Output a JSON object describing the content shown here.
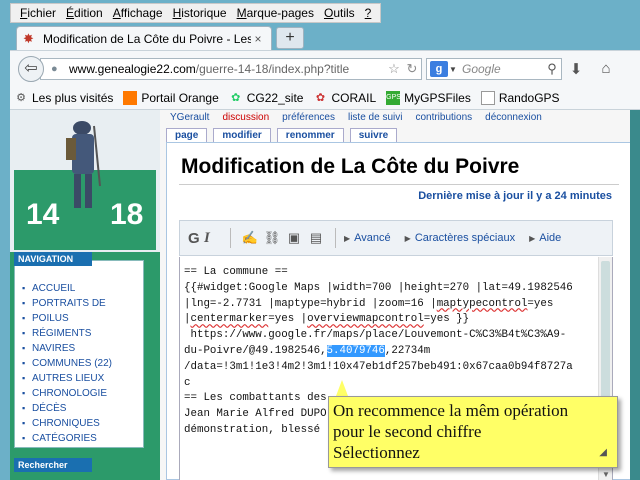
{
  "menu": [
    {
      "label": "Fichier",
      "u": "F",
      "rest": "ichier"
    },
    {
      "label": "Édition",
      "u": "É",
      "rest": "dition"
    },
    {
      "label": "Affichage",
      "u": "A",
      "rest": "ffichage"
    },
    {
      "label": "Historique",
      "u": "H",
      "rest": "istorique"
    },
    {
      "label": "Marque-pages",
      "u": "M",
      "rest": "arque-pages"
    },
    {
      "label": "Outils",
      "u": "O",
      "rest": "utils"
    },
    {
      "label": "?",
      "u": "?",
      "rest": ""
    }
  ],
  "tab": {
    "title": "Modification de La Côte du Poivre - Les ...",
    "close": "×",
    "new": "+"
  },
  "url": {
    "host": "www.genealogie22.com",
    "path": "/guerre-14-18/index.php?title"
  },
  "search": {
    "engine": "g",
    "placeholder": "Google"
  },
  "bookmarks": [
    {
      "label": "Les plus visités",
      "icon": "gear-icon"
    },
    {
      "label": "Portail Orange",
      "icon": "orange-icon"
    },
    {
      "label": "CG22_site",
      "icon": "cg22-icon"
    },
    {
      "label": "CORAIL",
      "icon": "corail-icon"
    },
    {
      "label": "MyGPSFiles",
      "icon": "gps-icon"
    },
    {
      "label": "RandoGPS",
      "icon": "page-icon"
    }
  ],
  "personal": [
    "YGerault",
    "discussion",
    "préférences",
    "liste de suivi",
    "contributions",
    "déconnexion"
  ],
  "page_tabs": [
    "page",
    "modifier",
    "renommer",
    "suivre"
  ],
  "logo": {
    "left_num": "14",
    "right_num": "18"
  },
  "heading": "Modification de La Côte du Poivre",
  "last_modified": "Dernière mise à jour il y a 24 minutes",
  "editor_toolbar": {
    "bold": "G",
    "italic": "I",
    "advanced": "Avancé",
    "special": "Caractères spéciaux",
    "help": "Aide"
  },
  "code": {
    "l1": "== La commune ==",
    "l2": "{{#widget:Google Maps |width=700 |height=270 |lat=49.1982546",
    "l3a": "|lng=-2.7731 |maptype=hybrid |zoom=16 |",
    "l3b": "maptypecontrol",
    "l3c": "=yes",
    "l4a": "|",
    "l4b": "centermarker",
    "l4c": "=yes |",
    "l4d": "overviewmapcontrol",
    "l4e": "=yes }}",
    "l5": " https://www.google.fr/maps/place/Louvemont-C%C3%B4t%C3%A9-",
    "l6a": "du-Poivre/@49.1982546,",
    "l6sel": "5.4079746",
    "l6b": ",22734m",
    "l7a": "/data=!3m1!1e3!4m2!3m1!1",
    "l7b": "0x47eb1df257beb491:0x67caa0b94f8727a",
    "l8": "c",
    "l9a": "== Les combattants des",
    "l10": "Jean Marie Alfred DUPO",
    "l11": "démonstration, blessé "
  },
  "nav": {
    "title": "NAVIGATION",
    "items": [
      "ACCUEIL",
      "PORTRAITS DE",
      "POILUS",
      "RÉGIMENTS",
      "NAVIRES",
      "COMMUNES (22)",
      "AUTRES LIEUX",
      "CHRONOLOGIE",
      "DÉCÈS",
      "CHRONIQUES",
      "CATÉGORIES"
    ],
    "search_title": "Rechercher"
  },
  "tooltip": {
    "l1": "On recommence la mêm opération",
    "l2": "pour le second chiffre",
    "l3": "Sélectionnez"
  },
  "colors": {
    "link": "#1a4fa0",
    "sidebar": "#2c9a6a",
    "tooltip": "#ffff66",
    "selection": "#3399ff"
  }
}
